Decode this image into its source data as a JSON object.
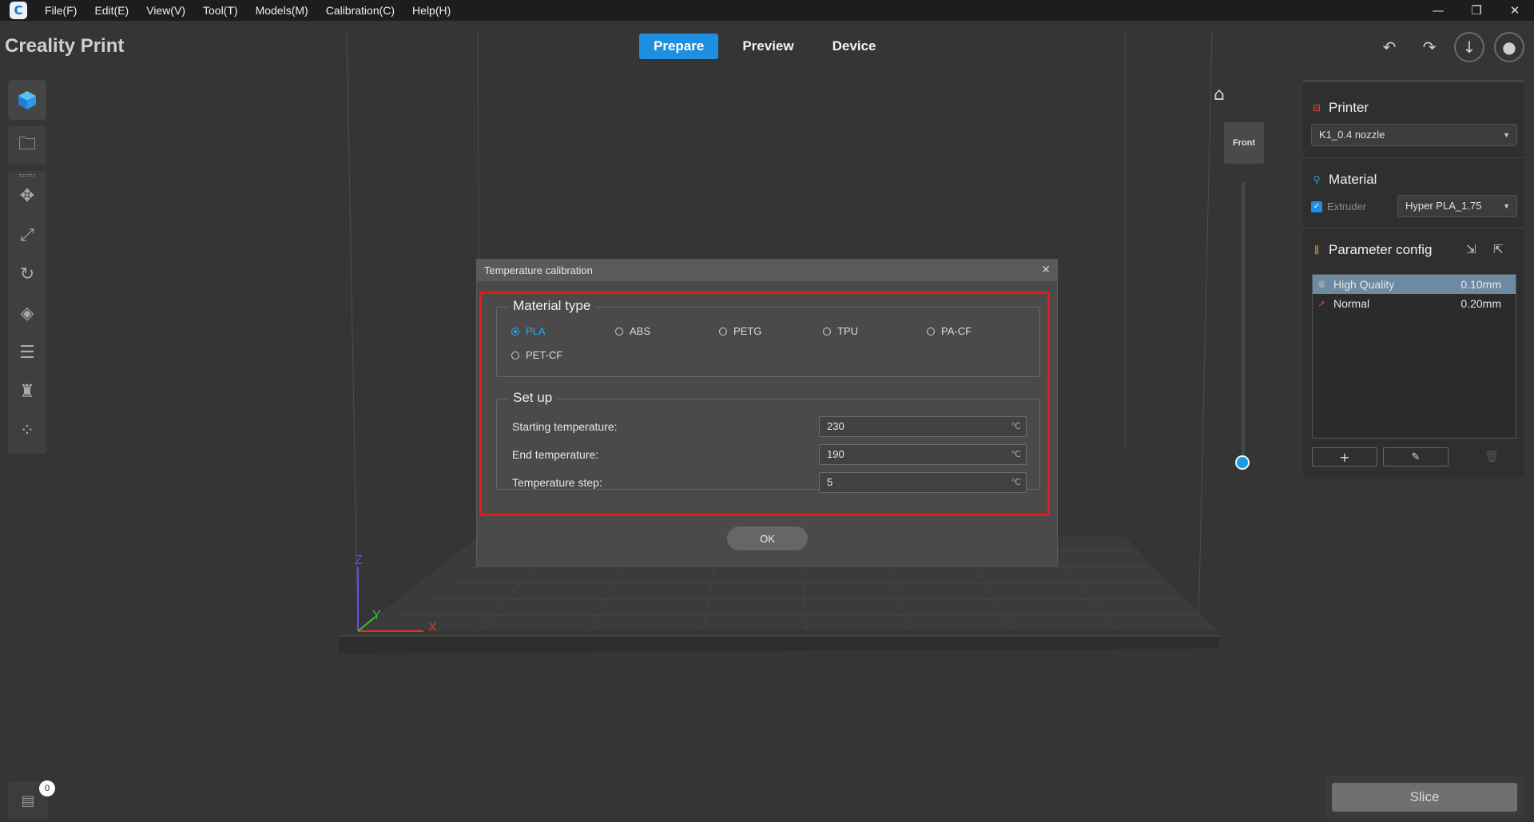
{
  "menubar": {
    "app_icon_glyph": "C",
    "items": [
      "File(F)",
      "Edit(E)",
      "View(V)",
      "Tool(T)",
      "Models(M)",
      "Calibration(C)",
      "Help(H)"
    ]
  },
  "header": {
    "brand": "Creality Print",
    "tabs": [
      "Prepare",
      "Preview",
      "Device"
    ],
    "active_tab": "Prepare",
    "accent_color": "#1d8ee0"
  },
  "viewport": {
    "view_label": "Front",
    "axis_labels": {
      "z": "Z",
      "y": "Y",
      "x": "X"
    }
  },
  "right_panel": {
    "printer": {
      "title": "Printer",
      "selected": "K1_0.4 nozzle"
    },
    "material": {
      "title": "Material",
      "extruder_label": "Extruder",
      "extruder_checked": true,
      "selected": "Hyper PLA_1.75"
    },
    "parameter_config": {
      "title": "Parameter config",
      "profiles": [
        {
          "name": "High Quality",
          "value": "0.10mm",
          "selected": true
        },
        {
          "name": "Normal",
          "value": "0.20mm",
          "selected": false
        }
      ]
    }
  },
  "bottom": {
    "object_count": "0",
    "slice_label": "Slice"
  },
  "dialog": {
    "title": "Temperature calibration",
    "material_type": {
      "legend": "Material type",
      "options": [
        "PLA",
        "ABS",
        "PETG",
        "TPU",
        "PA-CF",
        "PET-CF"
      ],
      "selected": "PLA"
    },
    "setup": {
      "legend": "Set up",
      "fields": [
        {
          "label": "Starting temperature:",
          "value": "230",
          "unit": "℃"
        },
        {
          "label": "End temperature:",
          "value": "190",
          "unit": "℃"
        },
        {
          "label": "Temperature step:",
          "value": "5",
          "unit": "℃"
        }
      ]
    },
    "ok_label": "OK",
    "highlight_color": "#e11c1c"
  }
}
